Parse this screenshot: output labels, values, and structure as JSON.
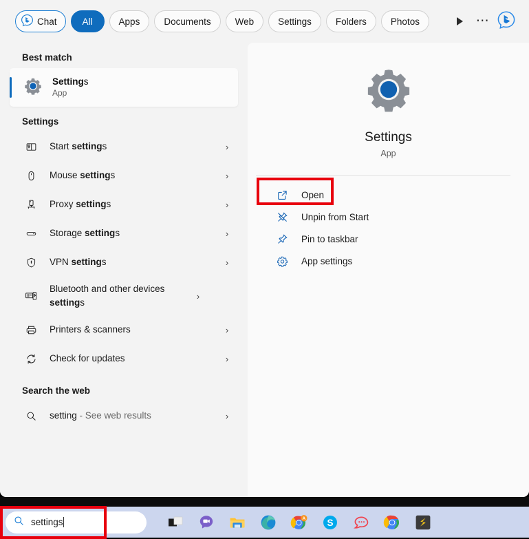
{
  "header": {
    "chat_pill": "Chat",
    "filters": [
      {
        "label": "All",
        "active": true
      },
      {
        "label": "Apps",
        "active": false
      },
      {
        "label": "Documents",
        "active": false
      },
      {
        "label": "Web",
        "active": false
      },
      {
        "label": "Settings",
        "active": false
      },
      {
        "label": "Folders",
        "active": false
      },
      {
        "label": "Photos",
        "active": false
      }
    ],
    "more_label": "…",
    "play_icon": "play-icon",
    "bing_icon": "bing-chat-icon"
  },
  "left": {
    "best_match_heading": "Best match",
    "best_match": {
      "title_bold": "Setting",
      "title_rest": "s",
      "subtitle": "App",
      "icon": "settings-gear-icon"
    },
    "settings_heading": "Settings",
    "settings_items": [
      {
        "prefix": "Start ",
        "bold": "setting",
        "suffix": "s",
        "icon": "start-menu-icon"
      },
      {
        "prefix": "Mouse ",
        "bold": "setting",
        "suffix": "s",
        "icon": "mouse-icon"
      },
      {
        "prefix": "Proxy ",
        "bold": "setting",
        "suffix": "s",
        "icon": "proxy-server-icon"
      },
      {
        "prefix": "Storage ",
        "bold": "setting",
        "suffix": "s",
        "icon": "storage-drive-icon"
      },
      {
        "prefix": "VPN ",
        "bold": "setting",
        "suffix": "s",
        "icon": "shield-vpn-icon"
      },
      {
        "prefix": "Bluetooth and other devices ",
        "bold": "setting",
        "suffix": "s",
        "icon": "bluetooth-devices-icon"
      },
      {
        "prefix": "Printers & scanners",
        "bold": "",
        "suffix": "",
        "icon": "printer-icon"
      },
      {
        "prefix": "Check for updates",
        "bold": "",
        "suffix": "",
        "icon": "refresh-updates-icon"
      }
    ],
    "web_heading": "Search the web",
    "web_item": {
      "query": "setting",
      "rest": " - See web results",
      "icon": "search-icon"
    },
    "chevron": "›"
  },
  "preview": {
    "app_name": "Settings",
    "app_type": "App",
    "icon": "settings-gear-icon",
    "actions": [
      {
        "label": "Open",
        "icon": "open-external-icon",
        "highlighted": true
      },
      {
        "label": "Unpin from Start",
        "icon": "unpin-icon",
        "highlighted": false
      },
      {
        "label": "Pin to taskbar",
        "icon": "pin-icon",
        "highlighted": false
      },
      {
        "label": "App settings",
        "icon": "gear-icon",
        "highlighted": false
      }
    ]
  },
  "taskbar": {
    "search_value": "settings",
    "search_icon": "search-icon",
    "apps": [
      {
        "name": "task-view-icon"
      },
      {
        "name": "teams-chat-icon"
      },
      {
        "name": "file-explorer-icon"
      },
      {
        "name": "edge-icon"
      },
      {
        "name": "chrome-beta-icon",
        "badge": "A"
      },
      {
        "name": "skype-icon"
      },
      {
        "name": "chat-bubble-icon"
      },
      {
        "name": "chrome-icon"
      },
      {
        "name": "sublime-text-icon"
      }
    ]
  },
  "colors": {
    "accent": "#0f6cbd",
    "annotation_red": "#e8000d",
    "panel_bg": "#f3f3f3",
    "taskbar_bg": "#ccd6ee"
  }
}
